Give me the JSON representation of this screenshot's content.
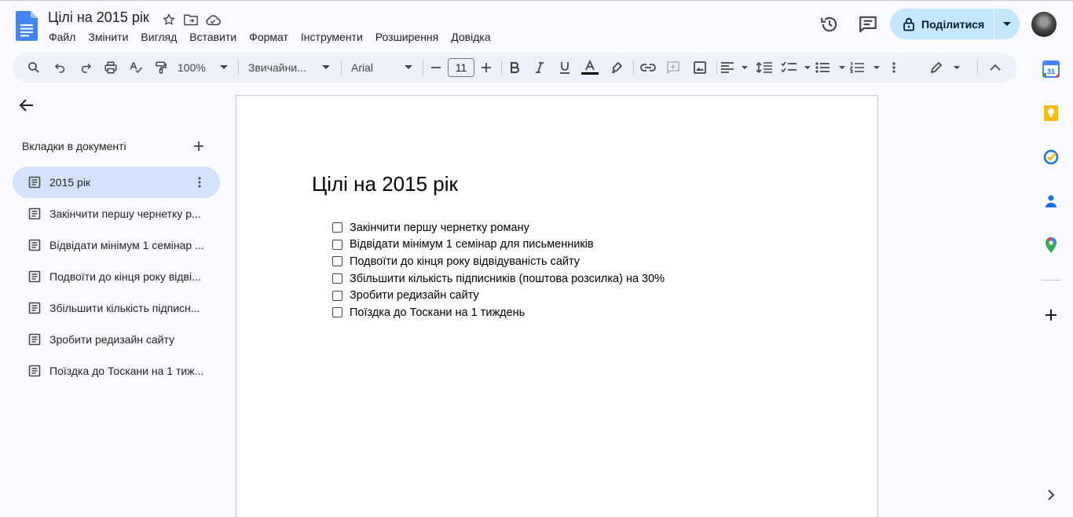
{
  "header": {
    "title": "Цілі на 2015 рік",
    "menu": [
      "Файл",
      "Змінити",
      "Вигляд",
      "Вставити",
      "Формат",
      "Інструменти",
      "Розширення",
      "Довідка"
    ],
    "share_label": "Поділитися"
  },
  "toolbar": {
    "zoom": "100%",
    "style": "Звичайни...",
    "font": "Arial",
    "font_size": "11"
  },
  "sidebar": {
    "title": "Вкладки в документі",
    "items": [
      {
        "label": "2015 рік"
      },
      {
        "label": "Закінчити першу чернетку р..."
      },
      {
        "label": "Відвідати мінімум 1 семінар ..."
      },
      {
        "label": "Подвоїти до кінця року відві..."
      },
      {
        "label": "Збільшити кількість підписн..."
      },
      {
        "label": "Зробити редизайн сайту"
      },
      {
        "label": "Поїздка до Тоскани на 1 тиж..."
      }
    ]
  },
  "document": {
    "heading": "Цілі на 2015 рік",
    "checklist": [
      "Закінчити першу чернетку роману",
      "Відвідати мінімум 1 семінар для письменників",
      "Подвоїти до кінця року відвідуваність сайту",
      "Збільшити кількість підписників (поштова розсилка) на 30%",
      "Зробити редизайн сайту",
      "Поїздка до Тоскани на 1 тиждень"
    ]
  },
  "side_panel": {
    "calendar_day": "31",
    "icons": [
      "calendar-icon",
      "keep-icon",
      "tasks-icon",
      "contacts-icon",
      "maps-icon",
      "add-icon",
      "expand-icon"
    ]
  },
  "colors": {
    "accent": "#0b57d0",
    "share_bg": "#c2e7ff",
    "active_tab": "#d3e3fd",
    "toolbar_bg": "#edf2fa"
  }
}
